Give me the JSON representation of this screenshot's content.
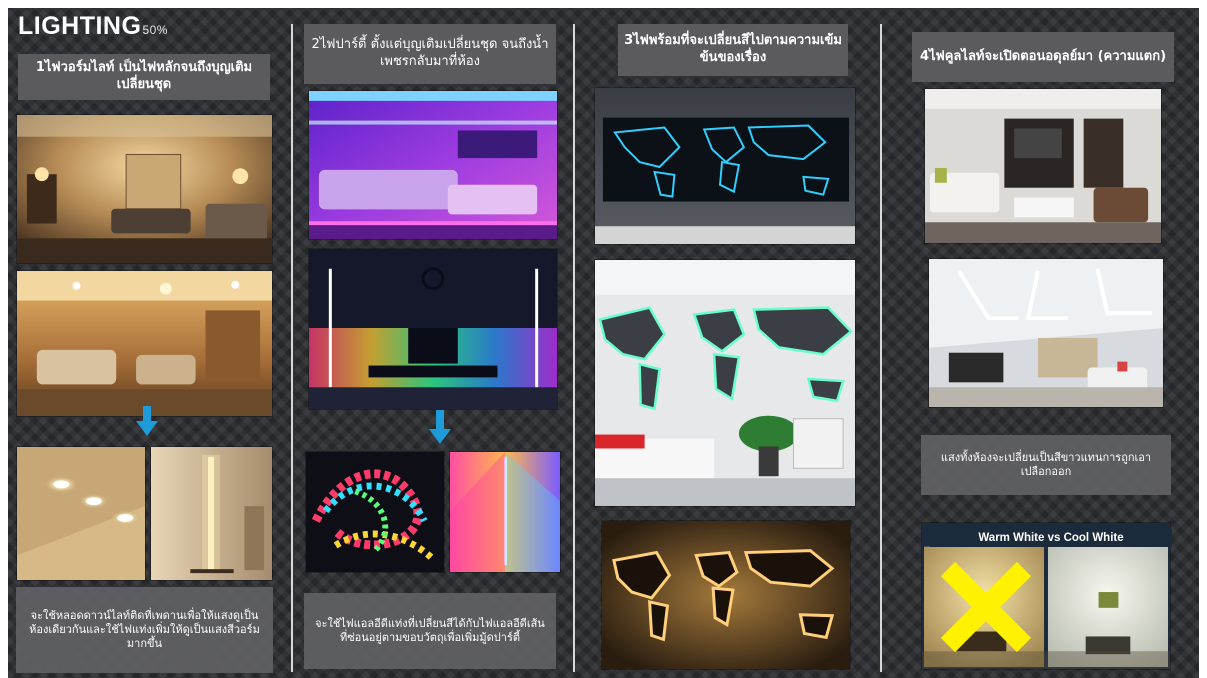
{
  "header": {
    "title": "LIGHTING",
    "percent": "50%"
  },
  "columns": [
    {
      "heading": "1ไฟวอร์มไลท์ เป็นไฟหลักจนถึงบุญเติมเปลี่ยนชุด",
      "caption": "จะใช้หลอดดาวน์ไลท์ติดที่เพดานเพื่อให้แสงดูเป็นห้องเดียวกันและใช้ไฟแท่งเพิ่มให้ดูเป็นแสงสีวอร์มมากขึ้น"
    },
    {
      "heading": "2ไฟปาร์ตี้ ตั้งแต่บุญเติมเปลี่ยนชุด จนถึงน้ำเพชรกลับมาที่ห้อง",
      "caption": "จะใช้ไฟแอลอีดีแท่งที่เปลี่ยนสีได้กับไฟแอลอีดีเส้นที่ซ่อนอยู่ตามขอบวัตถุเพื่อเพิ่มมู้ดปาร์ตี้"
    },
    {
      "heading": "3ไฟพร้อมที่จะเปลี่ยนสีไปตามความเข้มข้นของเรื่อง"
    },
    {
      "heading": "4ไฟคูลไลท์จะเปิดตอนอดุลย์มา (ความแตก)",
      "caption": "แสงทั้งห้องจะเปลี่ยนเป็นสีขาวแทนการถูกเอาเปลือกออก",
      "comparison_label": "Warm White vs Cool White"
    }
  ],
  "colors": {
    "accent_arrow": "#1e9bd8",
    "cross_mark": "#fff200",
    "label_bg": "#5b5b5e"
  },
  "icons": [
    "down-arrow-icon",
    "cross-mark-icon"
  ]
}
